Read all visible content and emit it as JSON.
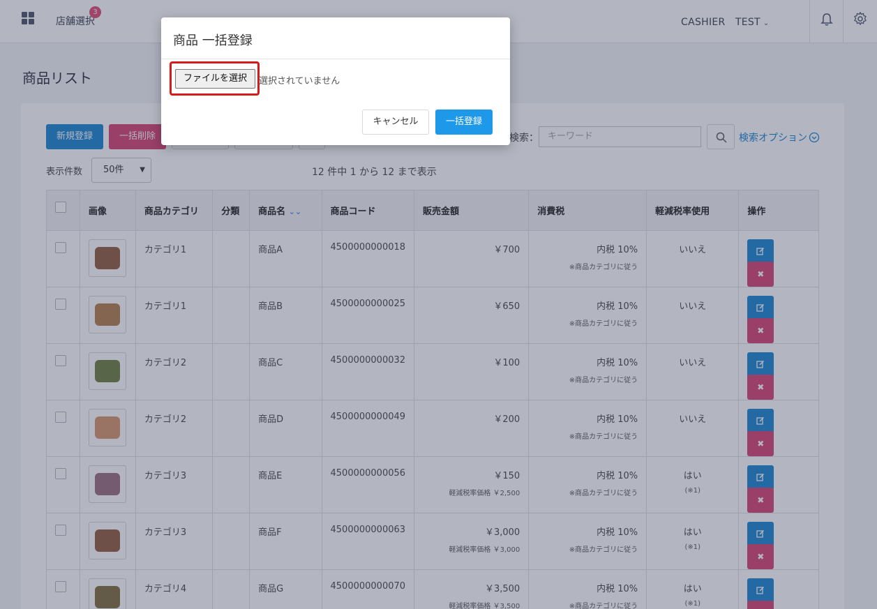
{
  "topbar": {
    "store_select": "店舗選択",
    "store_badge": "3",
    "user_menu": "CASHIER　TEST",
    "chevron": "⌄"
  },
  "page": {
    "title": "商品リスト"
  },
  "toolbar": {
    "new_label": "新規登録",
    "bulk_delete_label": "一括削除",
    "search_label": "検索：",
    "search_placeholder": "キーワード",
    "search_option": "検索オプション",
    "per_page_label": "表示件数",
    "per_page_value": "50件",
    "count_info": "12 件中 1 から 12 まで表示"
  },
  "table": {
    "headers": [
      "画像",
      "商品カテゴリ",
      "分類",
      "商品名",
      "商品コード",
      "販売金額",
      "消費税",
      "軽減税率使用",
      "操作"
    ],
    "rows": [
      {
        "category": "カテゴリ1",
        "name": "商品A",
        "code": "4500000000018",
        "price": "￥700",
        "price_sub": "",
        "tax": "内税 10%",
        "tax_sub": "※商品カテゴリに従う",
        "reduced": "いいえ",
        "reduced_sub": "",
        "food_color": "#9a6b4f"
      },
      {
        "category": "カテゴリ1",
        "name": "商品B",
        "code": "4500000000025",
        "price": "￥650",
        "price_sub": "",
        "tax": "内税 10%",
        "tax_sub": "※商品カテゴリに従う",
        "reduced": "いいえ",
        "reduced_sub": "",
        "food_color": "#b88a5a"
      },
      {
        "category": "カテゴリ2",
        "name": "商品C",
        "code": "4500000000032",
        "price": "￥100",
        "price_sub": "",
        "tax": "内税 10%",
        "tax_sub": "※商品カテゴリに従う",
        "reduced": "いいえ",
        "reduced_sub": "",
        "food_color": "#7b8a4e"
      },
      {
        "category": "カテゴリ2",
        "name": "商品D",
        "code": "4500000000049",
        "price": "￥200",
        "price_sub": "",
        "tax": "内税 10%",
        "tax_sub": "※商品カテゴリに従う",
        "reduced": "いいえ",
        "reduced_sub": "",
        "food_color": "#d9a07a"
      },
      {
        "category": "カテゴリ3",
        "name": "商品E",
        "code": "4500000000056",
        "price": "￥150",
        "price_sub": "軽減税率価格 ￥2,500",
        "tax": "内税 10%",
        "tax_sub": "※商品カテゴリに従う",
        "reduced": "はい",
        "reduced_sub": "(※1)",
        "food_color": "#a47b8a"
      },
      {
        "category": "カテゴリ3",
        "name": "商品F",
        "code": "4500000000063",
        "price": "￥3,000",
        "price_sub": "軽減税率価格 ￥3,000",
        "tax": "内税 10%",
        "tax_sub": "※商品カテゴリに従う",
        "reduced": "はい",
        "reduced_sub": "(※1)",
        "food_color": "#9a6b4f"
      },
      {
        "category": "カテゴリ4",
        "name": "商品G",
        "code": "4500000000070",
        "price": "￥3,500",
        "price_sub": "軽減税率価格 ￥3,500",
        "tax": "内税 10%",
        "tax_sub": "※商品カテゴリに従う",
        "reduced": "はい",
        "reduced_sub": "(※1)",
        "food_color": "#8a7a4e"
      }
    ]
  },
  "modal": {
    "title": "商品 一括登録",
    "file_button": "ファイルを選択",
    "file_status": "選択されていません",
    "cancel_label": "キャンセル",
    "register_label": "一括登録"
  },
  "colors": {
    "primary": "#2b8fd6",
    "danger": "#d9527e",
    "highlight": "#d71a1a"
  }
}
